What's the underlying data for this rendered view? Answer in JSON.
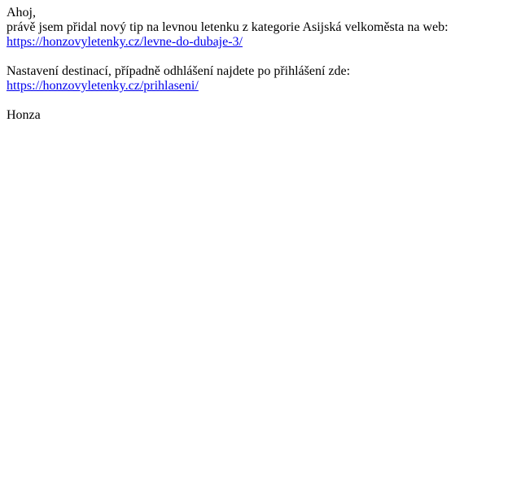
{
  "email": {
    "greeting": "Ahoj,",
    "intro": "právě jsem přidal nový tip na levnou letenku z kategorie Asijská velkoměsta na web:",
    "tip_link": "https://honzovyletenky.cz/levne-do-dubaje-3/",
    "settings_text": "Nastavení destinací, případně odhlášení najdete po přihlášení zde:",
    "login_link": "https://honzovyletenky.cz/prihlaseni/",
    "signature": "Honza"
  },
  "colors": {
    "text": "#000000",
    "link": "#0000ee",
    "background": "#ffffff"
  }
}
